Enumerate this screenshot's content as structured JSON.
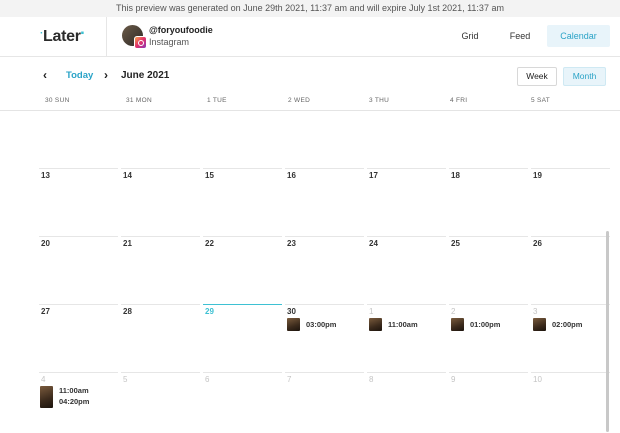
{
  "banner": {
    "text": "This preview was generated on June 29th 2021, 11:37 am and will expire July 1st 2021, 11:37 am"
  },
  "logo": {
    "text": "Later"
  },
  "account": {
    "handle": "@foryoufoodie",
    "network": "Instagram"
  },
  "nav": {
    "grid": "Grid",
    "feed": "Feed",
    "calendar": "Calendar"
  },
  "toolbar": {
    "today": "Today",
    "month": "June 2021",
    "week_btn": "Week",
    "month_btn": "Month"
  },
  "weekdays": [
    "30 SUN",
    "31 MON",
    "1 TUE",
    "2 WED",
    "3 THU",
    "4 FRI",
    "5 SAT"
  ],
  "weeks": [
    {
      "days": [
        "13",
        "14",
        "15",
        "16",
        "17",
        "18",
        "19"
      ]
    },
    {
      "days": [
        "20",
        "21",
        "22",
        "23",
        "24",
        "25",
        "26"
      ]
    },
    {
      "days": [
        "27",
        "28",
        "29",
        "30",
        "1",
        "2",
        "3"
      ]
    },
    {
      "days": [
        "4",
        "5",
        "6",
        "7",
        "8",
        "9",
        "10"
      ]
    }
  ],
  "posts": {
    "jun30": "03:00pm",
    "jul1": "11:00am",
    "jul2": "01:00pm",
    "jul3": "02:00pm",
    "jul4_a": "11:00am",
    "jul4_b": "04:20pm"
  }
}
